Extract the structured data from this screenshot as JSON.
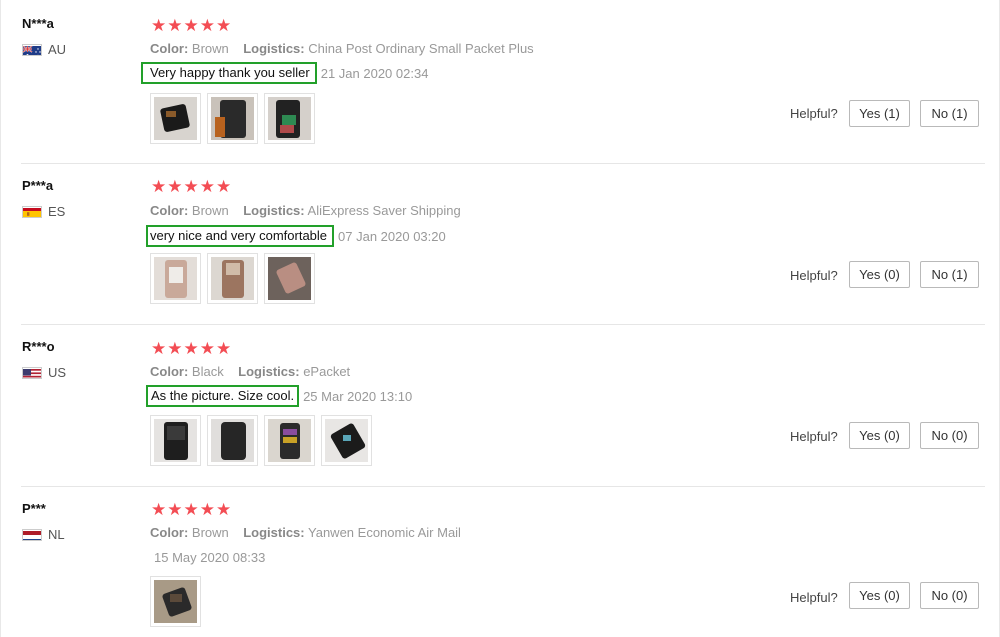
{
  "labels": {
    "color": "Color:",
    "logistics": "Logistics:",
    "helpful": "Helpful?"
  },
  "colors": {
    "star": "#f34d54",
    "comment_highlight": "#22a02a"
  },
  "reviews": [
    {
      "user": "N***a",
      "country": "AU",
      "flag": "australia-flag-icon",
      "rating": 5,
      "color": "Brown",
      "logistics": "China Post Ordinary Small Packet Plus",
      "comment": "Very happy thank you seller",
      "date": "21 Jan 2020 02:34",
      "yes": "Yes (1)",
      "no": "No (1)",
      "photo_count": 3
    },
    {
      "user": "P***a",
      "country": "ES",
      "flag": "spain-flag-icon",
      "rating": 5,
      "color": "Brown",
      "logistics": "AliExpress Saver Shipping",
      "comment": "very nice and very comfortable",
      "date": "07 Jan 2020 03:20",
      "yes": "Yes (0)",
      "no": "No (1)",
      "photo_count": 3
    },
    {
      "user": "R***o",
      "country": "US",
      "flag": "usa-flag-icon",
      "rating": 5,
      "color": "Black",
      "logistics": "ePacket",
      "comment": "As the picture. Size cool.",
      "date": "25 Mar 2020 13:10",
      "yes": "Yes (0)",
      "no": "No (0)",
      "photo_count": 4
    },
    {
      "user": "P***",
      "country": "NL",
      "flag": "netherlands-flag-icon",
      "rating": 5,
      "color": "Brown",
      "logistics": "Yanwen Economic Air Mail",
      "comment": "",
      "date": "15 May 2020 08:33",
      "yes": "Yes (0)",
      "no": "No (0)",
      "photo_count": 1
    }
  ]
}
